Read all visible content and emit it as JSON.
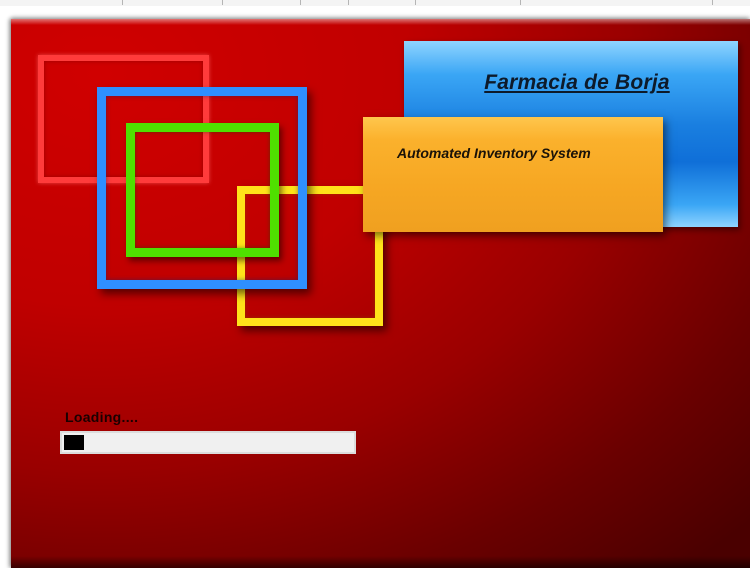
{
  "window": {
    "title_strip_visible": true
  },
  "splash": {
    "background_color": "#c00000",
    "decoration_colors": {
      "red": "#ff3b3b",
      "blue": "#2f8fff",
      "green": "#4fe000",
      "yellow": "#ffe21a"
    },
    "title": {
      "text": "Farmacia de Borja",
      "panel_color": "#1a7fe0"
    },
    "subtitle": {
      "text": "Automated Inventory System",
      "panel_color": "#f6a723"
    },
    "loading": {
      "label": "Loading....",
      "progress_fraction": 0.07
    }
  }
}
